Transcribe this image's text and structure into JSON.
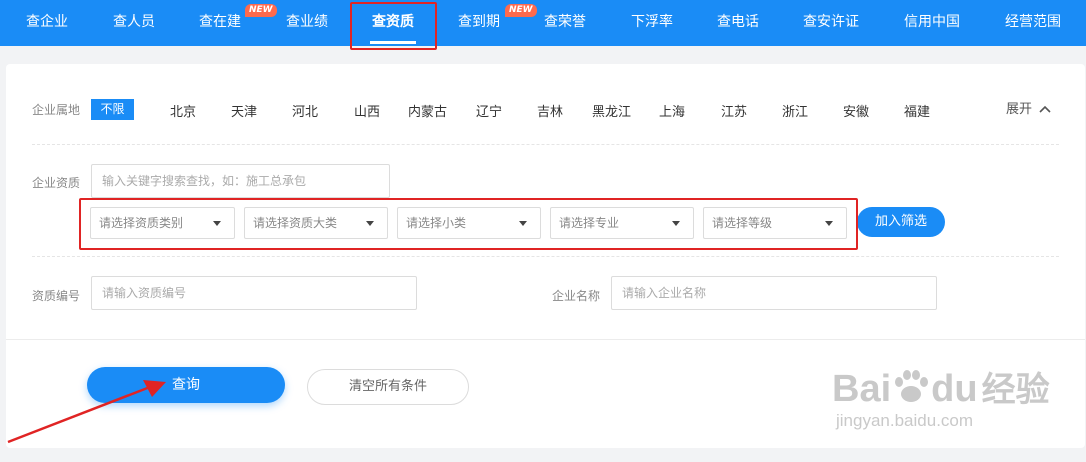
{
  "nav": {
    "items": [
      {
        "label": "查企业"
      },
      {
        "label": "查人员"
      },
      {
        "label": "查在建",
        "badge": "NEW"
      },
      {
        "label": "查业绩"
      },
      {
        "label": "查资质",
        "active": true
      },
      {
        "label": "查到期",
        "badge": "NEW"
      },
      {
        "label": "查荣誉"
      },
      {
        "label": "下浮率"
      },
      {
        "label": "查电话"
      },
      {
        "label": "查安许证"
      },
      {
        "label": "信用中国"
      },
      {
        "label": "经营范围"
      }
    ]
  },
  "filters": {
    "region_label": "企业属地",
    "region_all": "不限",
    "regions": [
      "北京",
      "天津",
      "河北",
      "山西",
      "内蒙古",
      "辽宁",
      "吉林",
      "黑龙江",
      "上海",
      "江苏",
      "浙江",
      "安徽",
      "福建"
    ],
    "expand_label": "展开",
    "qualification_label": "企业资质",
    "qualification_placeholder": "输入关键字搜索查找，如：施工总承包",
    "selects": [
      "请选择资质类别",
      "请选择资质大类",
      "请选择小类",
      "请选择专业",
      "请选择等级"
    ],
    "add_filter_label": "加入筛选",
    "cert_number_label": "资质编号",
    "cert_number_placeholder": "请输入资质编号",
    "company_name_label": "企业名称",
    "company_name_placeholder": "请输入企业名称"
  },
  "actions": {
    "query_label": "查询",
    "clear_label": "清空所有条件"
  },
  "watermark": {
    "brand": "Bai",
    "brand_tail": "du",
    "brand_cn": "经验",
    "url": "jingyan.baidu.com"
  },
  "colors": {
    "primary": "#1a8cf6",
    "highlight": "#e02424",
    "badge": "#ff6a4d"
  }
}
